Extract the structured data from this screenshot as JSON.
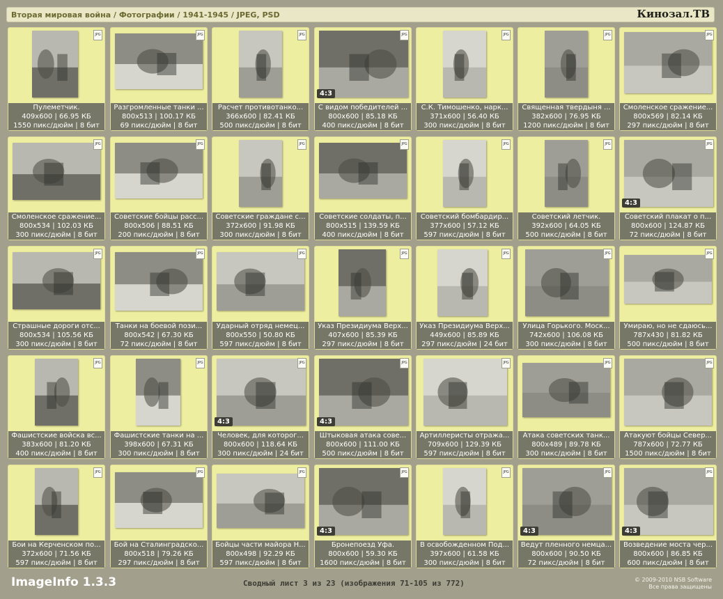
{
  "header": {
    "breadcrumb": "Вторая мировая война / Фотографии / 1941-1945 / JPEG, PSD",
    "brand": "Кинозал.ТВ"
  },
  "format_badge": "JPG",
  "items": [
    {
      "title": "Пулеметчик.",
      "info": "409x600 | 66.95 КБ",
      "meta": "1550 пикс/дюйм | 8 бит",
      "badge": ""
    },
    {
      "title": "Разгромленные танки ...",
      "info": "800x513 | 100.17 КБ",
      "meta": "69 пикс/дюйм | 8 бит",
      "badge": ""
    },
    {
      "title": "Расчет противотанко...",
      "info": "366x600 | 82.41 КБ",
      "meta": "500 пикс/дюйм | 8 бит",
      "badge": ""
    },
    {
      "title": "С видом победителей ...",
      "info": "800x600 | 85.18 КБ",
      "meta": "400 пикс/дюйм | 8 бит",
      "badge": "4:3"
    },
    {
      "title": "С.К. Тимошенко, нарк...",
      "info": "371x600 | 56.40 КБ",
      "meta": "300 пикс/дюйм | 8 бит",
      "badge": ""
    },
    {
      "title": "Священная твердыня ...",
      "info": "382x600 | 76.95 КБ",
      "meta": "1200 пикс/дюйм | 8 бит",
      "badge": ""
    },
    {
      "title": "Смоленское сражение...",
      "info": "800x569 | 82.14 КБ",
      "meta": "297 пикс/дюйм | 8 бит",
      "badge": ""
    },
    {
      "title": "Смоленское сражение...",
      "info": "800x534 | 102.03 КБ",
      "meta": "300 пикс/дюйм | 8 бит",
      "badge": ""
    },
    {
      "title": "Советские бойцы расс...",
      "info": "800x506 | 88.51 КБ",
      "meta": "200 пикс/дюйм | 8 бит",
      "badge": ""
    },
    {
      "title": "Советские граждане с...",
      "info": "372x600 | 91.98 КБ",
      "meta": "300 пикс/дюйм | 8 бит",
      "badge": ""
    },
    {
      "title": "Советские солдаты, п...",
      "info": "800x515 | 139.59 КБ",
      "meta": "400 пикс/дюйм | 8 бит",
      "badge": ""
    },
    {
      "title": "Советский бомбардир...",
      "info": "377x600 | 57.12 КБ",
      "meta": "597 пикс/дюйм | 8 бит",
      "badge": ""
    },
    {
      "title": "Советский летчик.",
      "info": "392x600 | 64.05 КБ",
      "meta": "500 пикс/дюйм | 8 бит",
      "badge": ""
    },
    {
      "title": "Советский плакат о п...",
      "info": "800x600 | 124.87 КБ",
      "meta": "72 пикс/дюйм | 8 бит",
      "badge": "4:3"
    },
    {
      "title": "Страшные дороги отс...",
      "info": "800x534 | 105.56 КБ",
      "meta": "300 пикс/дюйм | 8 бит",
      "badge": ""
    },
    {
      "title": "Танки на боевой пози...",
      "info": "800x542 | 67.30 КБ",
      "meta": "72 пикс/дюйм | 8 бит",
      "badge": ""
    },
    {
      "title": "Ударный отряд немец...",
      "info": "800x550 | 50.80 КБ",
      "meta": "597 пикс/дюйм | 8 бит",
      "badge": ""
    },
    {
      "title": "Указ Президиума Верх...",
      "info": "407x600 | 85.39 КБ",
      "meta": "297 пикс/дюйм | 8 бит",
      "badge": ""
    },
    {
      "title": "Указ Президиума Верх...",
      "info": "449x600 | 85.89 КБ",
      "meta": "297 пикс/дюйм | 24 бит",
      "badge": ""
    },
    {
      "title": "Улица Горького. Моск...",
      "info": "742x600 | 106.08 КБ",
      "meta": "300 пикс/дюйм | 8 бит",
      "badge": ""
    },
    {
      "title": "Умираю, но не сдаюсь...",
      "info": "787x430 | 81.82 КБ",
      "meta": "500 пикс/дюйм | 8 бит",
      "badge": ""
    },
    {
      "title": "Фашистские войска вс...",
      "info": "383x600 | 81.20 КБ",
      "meta": "400 пикс/дюйм | 8 бит",
      "badge": ""
    },
    {
      "title": "Фашистские танки на ...",
      "info": "398x600 | 67.31 КБ",
      "meta": "300 пикс/дюйм | 8 бит",
      "badge": ""
    },
    {
      "title": "Человек, для которог...",
      "info": "800x600 | 118.64 КБ",
      "meta": "300 пикс/дюйм | 24 бит",
      "badge": "4:3"
    },
    {
      "title": "Штыковая атака сове...",
      "info": "800x600 | 111.00 КБ",
      "meta": "500 пикс/дюйм | 8 бит",
      "badge": "4:3"
    },
    {
      "title": "Артиллеристы отража...",
      "info": "709x600 | 129.39 КБ",
      "meta": "597 пикс/дюйм | 8 бит",
      "badge": ""
    },
    {
      "title": "Атака советских танк...",
      "info": "800x489 | 89.78 КБ",
      "meta": "300 пикс/дюйм | 8 бит",
      "badge": ""
    },
    {
      "title": "Атакуют бойцы Север...",
      "info": "787x600 | 72.77 КБ",
      "meta": "1500 пикс/дюйм | 8 бит",
      "badge": ""
    },
    {
      "title": "Бои на Керченском по...",
      "info": "372x600 | 71.56 КБ",
      "meta": "597 пикс/дюйм | 8 бит",
      "badge": ""
    },
    {
      "title": "Бой на Сталинградско...",
      "info": "800x518 | 79.26 КБ",
      "meta": "297 пикс/дюйм | 8 бит",
      "badge": ""
    },
    {
      "title": "Бойцы части майора Н...",
      "info": "800x498 | 92.29 КБ",
      "meta": "597 пикс/дюйм | 8 бит",
      "badge": ""
    },
    {
      "title": "Бронепоезд Уфа.",
      "info": "800x600 | 59.30 КБ",
      "meta": "1600 пикс/дюйм | 8 бит",
      "badge": "4:3"
    },
    {
      "title": "В освобожденном Под...",
      "info": "397x600 | 61.58 КБ",
      "meta": "300 пикс/дюйм | 8 бит",
      "badge": ""
    },
    {
      "title": "Ведут пленного немца...",
      "info": "800x600 | 90.50 КБ",
      "meta": "72 пикс/дюйм | 8 бит",
      "badge": "4:3"
    },
    {
      "title": "Возведение моста чер...",
      "info": "800x600 | 86.85 КБ",
      "meta": "600 пикс/дюйм | 8 бит",
      "badge": "4:3"
    }
  ],
  "footer": {
    "app_name": "ImageInfo 1.3.3",
    "sheet": "Сводный лист 3 из 23 (изображения 71-105 из 772)",
    "copyright": "© 2009-2010 NSB Software",
    "rights": "Все права защищены"
  }
}
